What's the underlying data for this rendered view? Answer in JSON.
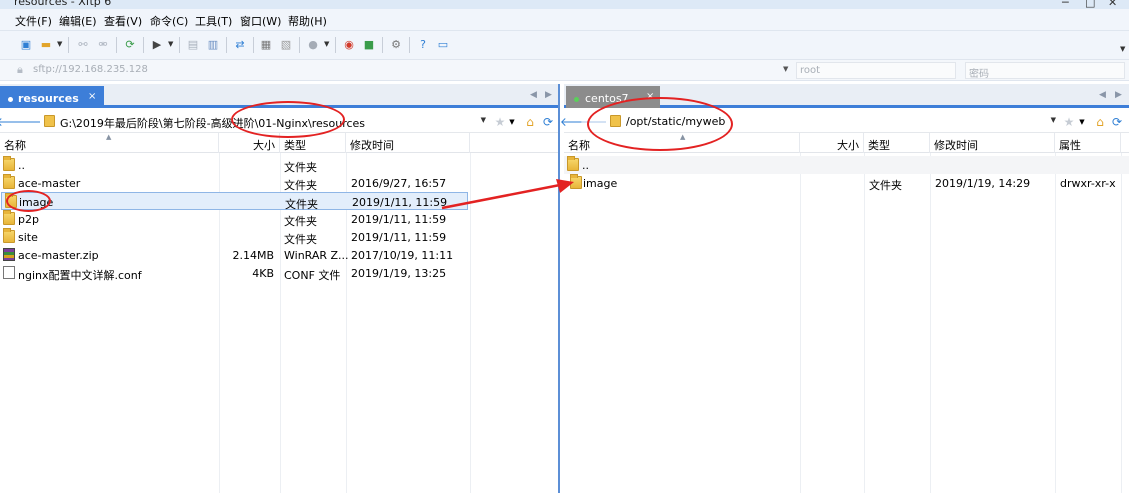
{
  "window": {
    "title": "resources - Xftp 6"
  },
  "menu": [
    "文件(F)",
    "编辑(E)",
    "查看(V)",
    "命令(C)",
    "工具(T)",
    "窗口(W)",
    "帮助(H)"
  ],
  "address": {
    "host": "sftp://192.168.235.128",
    "user": "root",
    "password": "密码"
  },
  "left": {
    "tab": "resources",
    "path": "G:\\2019年最后阶段\\第七阶段-高级进阶\\01-Nginx\\resources",
    "columns": [
      "名称",
      "大小",
      "类型",
      "修改时间"
    ],
    "rows": [
      {
        "name": "..",
        "size": "",
        "type": "文件夹",
        "date": "",
        "icon": "folder-icon"
      },
      {
        "name": "ace-master",
        "size": "",
        "type": "文件夹",
        "date": "2016/9/27, 16:57",
        "icon": "folder-icon"
      },
      {
        "name": "image",
        "size": "",
        "type": "文件夹",
        "date": "2019/1/11, 11:59",
        "icon": "folder-icon"
      },
      {
        "name": "p2p",
        "size": "",
        "type": "文件夹",
        "date": "2019/1/11, 11:59",
        "icon": "folder-icon"
      },
      {
        "name": "site",
        "size": "",
        "type": "文件夹",
        "date": "2019/1/11, 11:59",
        "icon": "folder-icon"
      },
      {
        "name": "ace-master.zip",
        "size": "2.14MB",
        "type": "WinRAR Z...",
        "date": "2017/10/19, 11:11",
        "icon": "zip-icon"
      },
      {
        "name": "nginx配置中文详解.conf",
        "size": "4KB",
        "type": "CONF 文件",
        "date": "2019/1/19, 13:25",
        "icon": "file-icon"
      }
    ]
  },
  "right": {
    "tab": "centos7",
    "path": "/opt/static/myweb",
    "columns": [
      "名称",
      "大小",
      "类型",
      "修改时间",
      "属性"
    ],
    "rows": [
      {
        "name": "..",
        "size": "",
        "type": "",
        "date": "",
        "attr": "",
        "icon": "folder-icon"
      },
      {
        "name": "image",
        "size": "",
        "type": "文件夹",
        "date": "2019/1/19, 14:29",
        "attr": "drwxr-xr-x",
        "icon": "folder-icon"
      }
    ]
  },
  "colors": {
    "tab_active": "#3d7ed8",
    "tab_inactive": "#8c8c8c",
    "annotation": "#e32222",
    "selection": "#e3eefb"
  }
}
